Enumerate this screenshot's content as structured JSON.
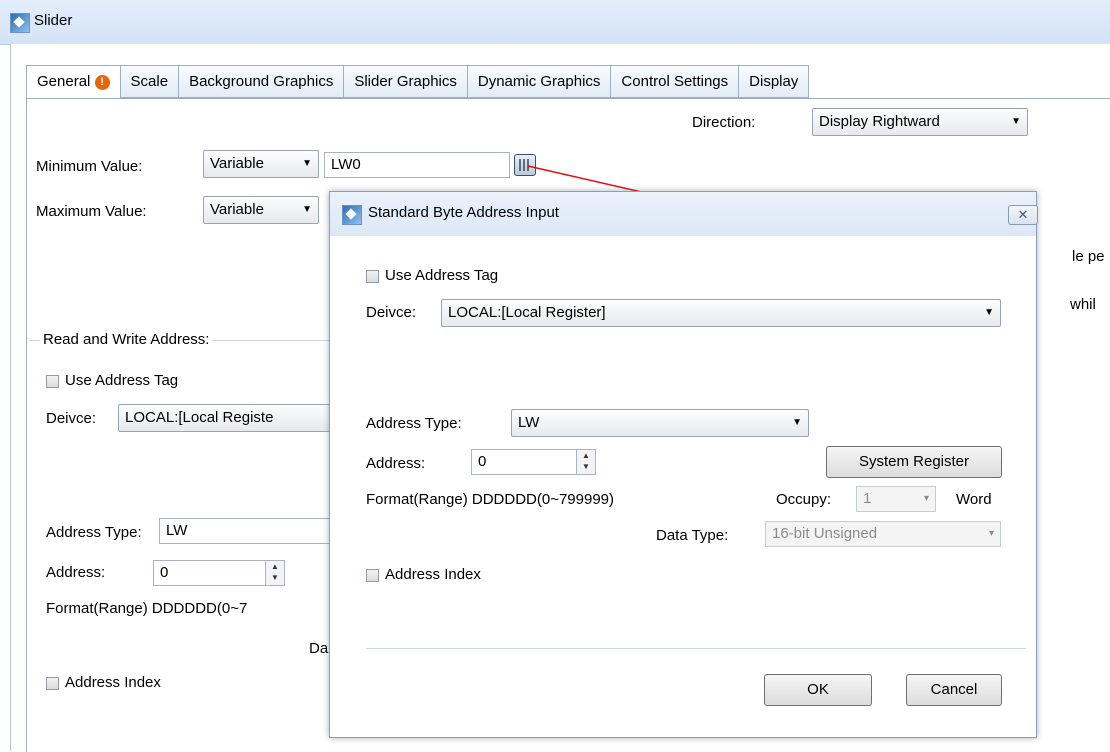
{
  "window": {
    "title": "Slider"
  },
  "tabs": [
    "General",
    "Scale",
    "Background Graphics",
    "Slider Graphics",
    "Dynamic Graphics",
    "Control Settings",
    "Display"
  ],
  "general": {
    "direction_label": "Direction:",
    "direction_value": "Display Rightward",
    "min_label": "Minimum Value:",
    "min_type": "Variable",
    "min_value": "LW0",
    "max_label": "Maximum Value:",
    "max_type": "Variable",
    "rw_group": "Read and Write Address:",
    "use_tag": "Use Address Tag",
    "device_label": "Deivce:",
    "device_value": "LOCAL:[Local Registe",
    "addr_type_label": "Address Type:",
    "addr_type_value": "LW",
    "address_label": "Address:",
    "address_value": "0",
    "format_text": "Format(Range) DDDDDD(0~7",
    "da_text": "Da",
    "address_index": "Address Index",
    "right_text_1": "le pe",
    "right_text_2": "whil"
  },
  "dialog": {
    "title": "Standard Byte Address Input",
    "close": "✕",
    "use_tag": "Use Address Tag",
    "device_label": "Deivce:",
    "device_value": "LOCAL:[Local Register]",
    "addr_type_label": "Address Type:",
    "addr_type_value": "LW",
    "address_label": "Address:",
    "address_value": "0",
    "system_register": "System Register",
    "format_text": "Format(Range) DDDDDD(0~799999)",
    "occupy_label": "Occupy:",
    "occupy_value": "1",
    "occupy_unit": "Word",
    "data_type_label": "Data Type:",
    "data_type_value": "16-bit Unsigned",
    "address_index": "Address Index",
    "ok": "OK",
    "cancel": "Cancel"
  }
}
